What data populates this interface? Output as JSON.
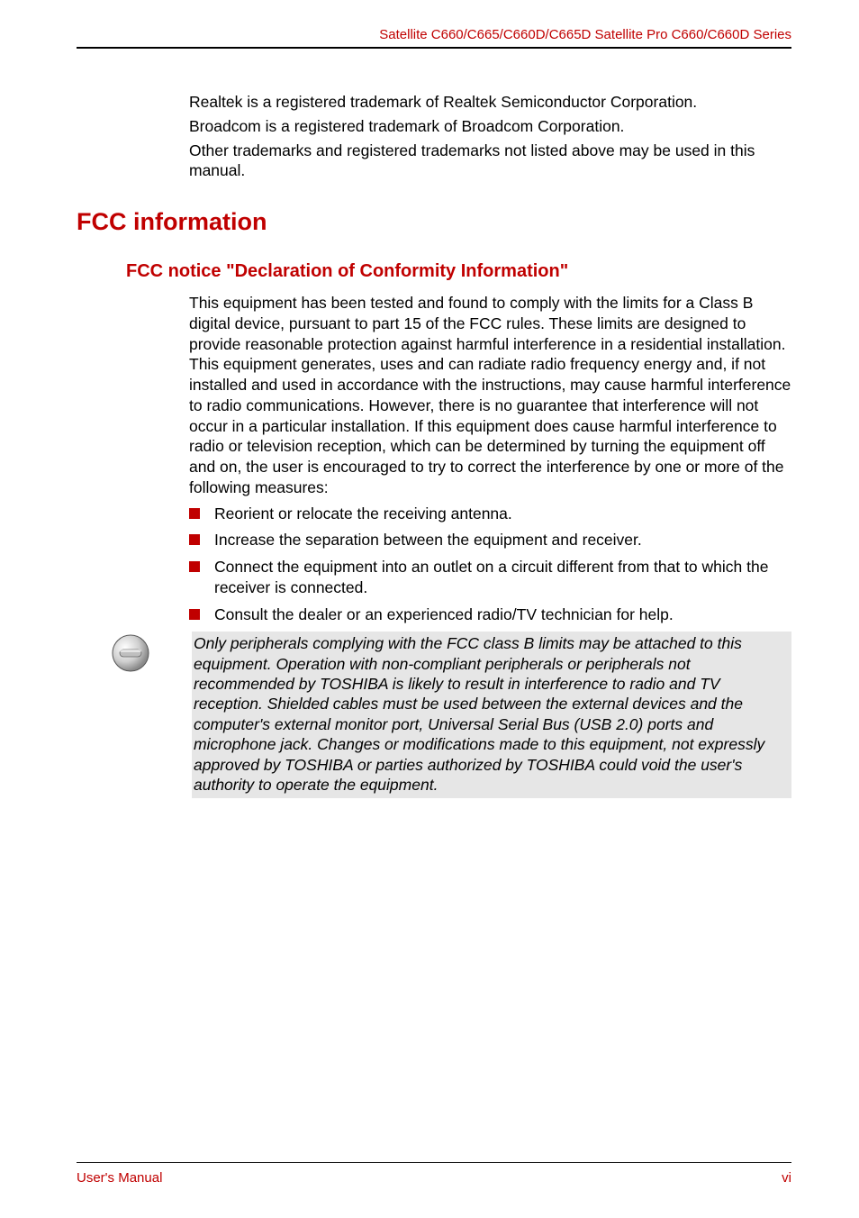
{
  "header": {
    "product_line": "Satellite C660/C665/C660D/C665D Satellite Pro C660/C660D Series"
  },
  "intro": {
    "p1": "Realtek is a registered trademark of Realtek Semiconductor Corporation.",
    "p2": "Broadcom is a registered trademark of Broadcom Corporation.",
    "p3": "Other trademarks and registered trademarks not listed above may be used in this manual."
  },
  "fcc": {
    "heading": "FCC information",
    "subheading": "FCC notice \"Declaration of Conformity Information\"",
    "body": "This equipment has been tested and found to comply with the limits for a Class B digital device, pursuant to part 15 of the FCC rules. These limits are designed to provide reasonable protection against harmful interference in a residential installation. This equipment generates, uses and can radiate radio frequency energy and, if not installed and used in accordance with the instructions, may cause harmful interference to radio communications. However, there is no guarantee that interference will not occur in a particular installation. If this equipment does cause harmful interference to radio or television reception, which can be determined by turning the equipment off and on, the user is encouraged to try to correct the interference by one or more of the following measures:",
    "bullets": [
      "Reorient or relocate the receiving antenna.",
      "Increase the separation between the equipment and receiver.",
      "Connect the equipment into an outlet on a circuit different from that to which the receiver is connected.",
      "Consult the dealer or an experienced radio/TV technician for help."
    ],
    "note": "Only peripherals complying with the FCC class B limits may be attached to this equipment. Operation with non-compliant peripherals or peripherals not recommended by TOSHIBA is likely to result in interference to radio and TV reception. Shielded cables must be used between the external devices and the computer's external monitor port, Universal Serial Bus (USB 2.0) ports and microphone jack. Changes or modifications made to this equipment, not expressly approved by TOSHIBA or parties authorized by TOSHIBA could void the user's authority to operate the equipment."
  },
  "footer": {
    "left": "User's Manual",
    "right": "vi"
  }
}
